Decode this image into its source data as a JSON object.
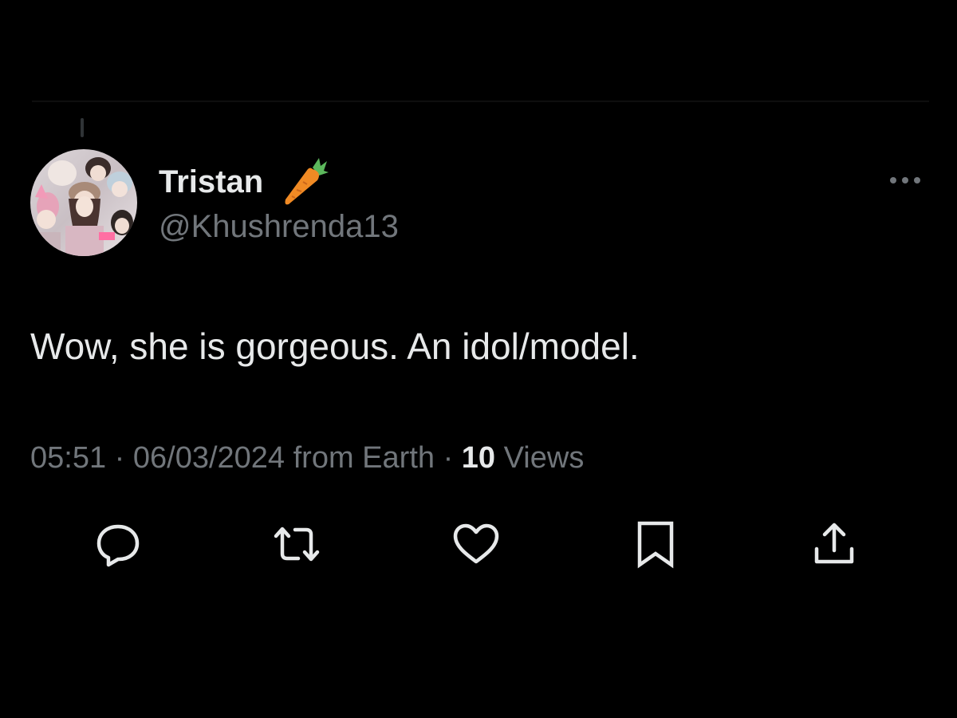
{
  "tweet": {
    "author": {
      "display_name": "Tristan",
      "handle": "@Khushrenda13",
      "name_emoji": "carrot-icon"
    },
    "text": "Wow, she is gorgeous. An idol/model.",
    "meta": {
      "time": "05:51",
      "date": "06/03/2024",
      "source": "from Earth",
      "separator": "·",
      "views_count": "10",
      "views_label": "Views"
    },
    "actions": [
      {
        "name": "reply",
        "icon": "reply-icon"
      },
      {
        "name": "retweet",
        "icon": "retweet-icon"
      },
      {
        "name": "like",
        "icon": "heart-icon"
      },
      {
        "name": "bookmark",
        "icon": "bookmark-icon"
      },
      {
        "name": "share",
        "icon": "share-icon"
      }
    ]
  },
  "theme": {
    "background": "#000000",
    "primary_text": "#e7e9ea",
    "secondary_text": "#71767b"
  }
}
